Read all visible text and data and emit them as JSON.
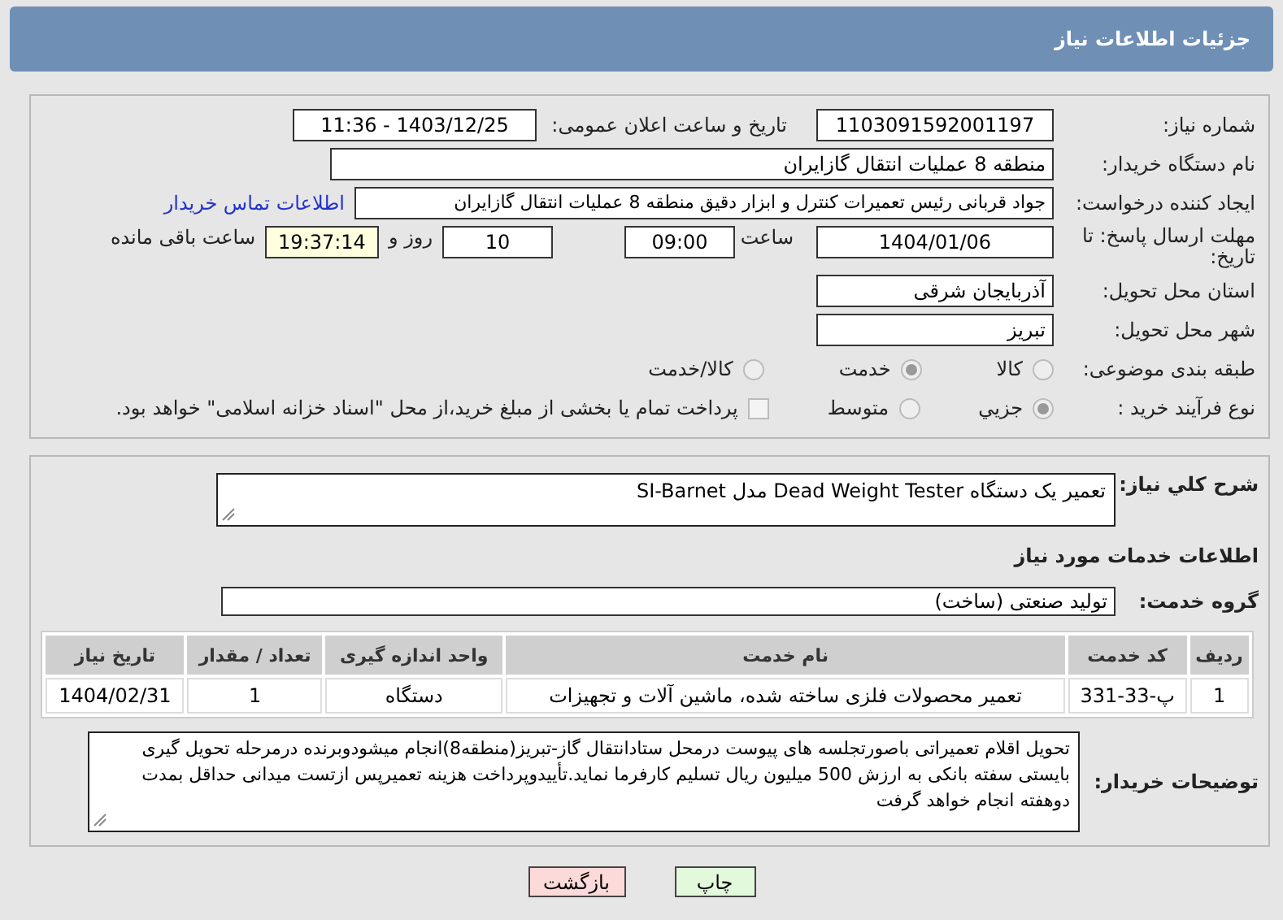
{
  "header": {
    "title": "جزئیات اطلاعات نیاز"
  },
  "details": {
    "need_number": {
      "label": "شماره نیاز:",
      "value": "1103091592001197"
    },
    "announce_datetime": {
      "label": "تاریخ و ساعت اعلان عمومی:",
      "value": "1403/12/25 - 11:36"
    },
    "buyer": {
      "label": "نام دستگاه خریدار:",
      "value": "منطقه 8 عملیات انتقال گازایران"
    },
    "creator": {
      "label": "ایجاد کننده درخواست:",
      "value": "جواد قربانی رئیس تعمیرات کنترل و ابزار دقیق منطقه 8 عملیات انتقال گازایران",
      "link": "اطلاعات تماس خریدار"
    },
    "deadline": {
      "label": "مهلت ارسال پاسخ: تا تاریخ:",
      "date": "1404/01/06",
      "time_label": "ساعت",
      "time": "09:00",
      "days": "10",
      "days_label": "روز و",
      "remaining": "19:37:14",
      "remaining_label": "ساعت باقی مانده"
    },
    "province": {
      "label": "استان محل تحویل:",
      "value": "آذربایجان شرقی"
    },
    "city": {
      "label": "شهر محل تحویل:",
      "value": "تبریز"
    },
    "category": {
      "label": "طبقه بندی موضوعی:",
      "options": [
        {
          "label": "کالا",
          "selected": false
        },
        {
          "label": "خدمت",
          "selected": true
        },
        {
          "label": "کالا/خدمت",
          "selected": false
        }
      ]
    },
    "process": {
      "label": "نوع فرآیند خرید :",
      "options": [
        {
          "label": "جزیي",
          "selected": true
        },
        {
          "label": "متوسط",
          "selected": false
        }
      ],
      "payment": {
        "checked": false,
        "label": "پرداخت تمام یا بخشی از مبلغ خرید،از محل \"اسناد خزانه اسلامی\" خواهد بود."
      }
    }
  },
  "services": {
    "summary": {
      "label": "شرح کلي نياز:",
      "value": "تعمیر یک دستگاه Dead Weight Tester مدل SI-Barnet"
    },
    "section_title": "اطلاعات خدمات مورد نیاز",
    "group": {
      "label": "گروه خدمت:",
      "value": "تولید صنعتی (ساخت)"
    },
    "table": {
      "columns": [
        "ردیف",
        "کد خدمت",
        "نام خدمت",
        "واحد اندازه گیری",
        "تعداد / مقدار",
        "تاریخ نیاز"
      ],
      "rows": [
        [
          "1",
          "پ-33-331",
          "تعمیر محصولات فلزی ساخته شده، ماشین آلات و تجهیزات",
          "دستگاه",
          "1",
          "1404/02/31"
        ]
      ]
    },
    "notes": {
      "label": "توضیحات خریدار:",
      "value": "تحویل اقلام تعمیراتی باصورتجلسه های پیوست درمحل ستادانتقال گاز-تبریز(منطقه8)انجام میشودوبرنده درمرحله تحویل گیری بایستی سفته بانکی به ارزش 500 میلیون ریال تسلیم کارفرما نماید.تأییدوپرداخت هزینه تعمیرپس ازتست میدانی حداقل بمدت دوهفته انجام خواهد گرفت"
    }
  },
  "buttons": [
    {
      "kind": "print",
      "label": "چاپ"
    },
    {
      "kind": "back",
      "label": "بازگشت"
    }
  ]
}
